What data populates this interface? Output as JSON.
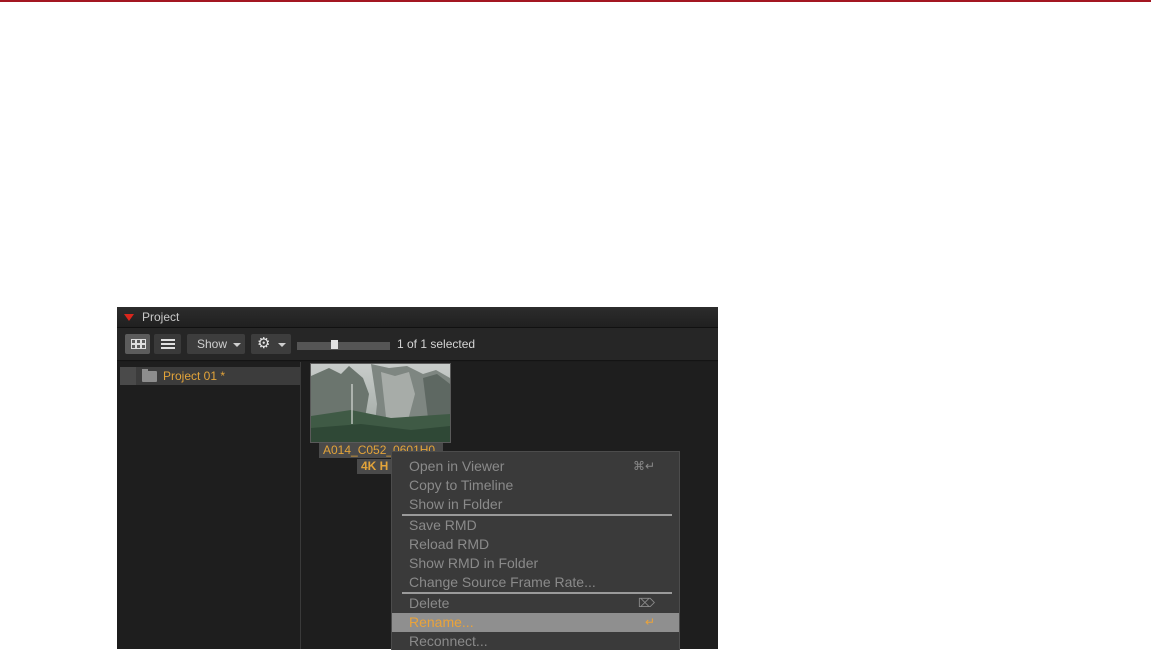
{
  "panel": {
    "title": "Project",
    "toolbar": {
      "show_label": "Show",
      "selection_text": "1 of 1 selected"
    },
    "tree": {
      "items": [
        {
          "label": "Project 01 *"
        }
      ]
    },
    "clip": {
      "name": "A014_C052_0601H0",
      "resolution": "4K H"
    }
  },
  "context_menu": {
    "items": [
      {
        "label": "Open in Viewer",
        "shortcut": "⌘↵"
      },
      {
        "label": "Copy to Timeline",
        "shortcut": ""
      },
      {
        "label": "Show in Folder",
        "shortcut": ""
      },
      {
        "label": "Save RMD",
        "shortcut": ""
      },
      {
        "label": "Reload RMD",
        "shortcut": ""
      },
      {
        "label": "Show RMD in Folder",
        "shortcut": ""
      },
      {
        "label": "Change Source Frame Rate...",
        "shortcut": ""
      },
      {
        "label": "Delete",
        "shortcut": "⌦"
      },
      {
        "label": "Rename...",
        "shortcut": "↵"
      },
      {
        "label": "Reconnect...",
        "shortcut": ""
      }
    ]
  },
  "colors": {
    "accent": "#e3a43a",
    "brand_red": "#d9261c",
    "panel_bg": "#1c1c1c",
    "menu_bg": "#3a3a3a",
    "menu_highlight": "#8f8f8f"
  },
  "icons": {
    "collapse": "triangle-down-icon",
    "grid_view": "grid-view-icon",
    "list_view": "list-view-icon",
    "settings": "gear-icon",
    "folder": "folder-icon"
  }
}
